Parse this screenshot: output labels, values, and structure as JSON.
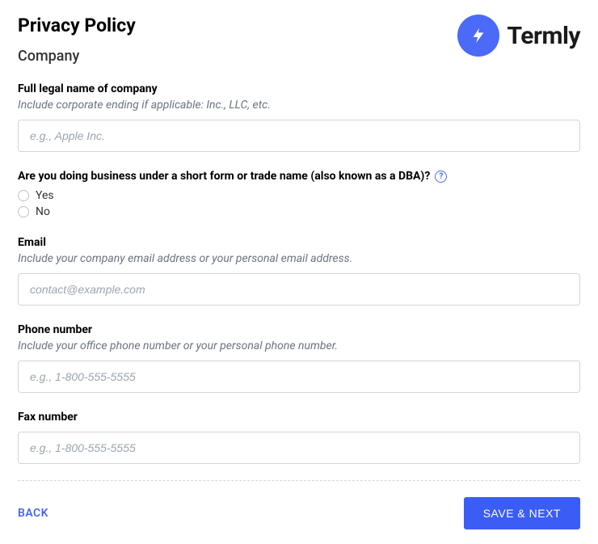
{
  "header": {
    "page_title": "Privacy Policy",
    "section_title": "Company",
    "brand_name": "Termly"
  },
  "fields": {
    "company_name": {
      "label": "Full legal name of company",
      "hint": "Include corporate ending if applicable: Inc., LLC, etc.",
      "placeholder": "e.g., Apple Inc."
    },
    "dba_question": {
      "label": "Are you doing business under a short form or trade name (also known as a DBA)?",
      "options": {
        "yes": "Yes",
        "no": "No"
      }
    },
    "email": {
      "label": "Email",
      "hint": "Include your company email address or your personal email address.",
      "placeholder": "contact@example.com"
    },
    "phone": {
      "label": "Phone number",
      "hint": "Include your office phone number or your personal phone number.",
      "placeholder": "e.g., 1-800-555-5555"
    },
    "fax": {
      "label": "Fax number",
      "placeholder": "e.g., 1-800-555-5555"
    }
  },
  "footer": {
    "back_label": "BACK",
    "save_label": "SAVE & NEXT"
  }
}
